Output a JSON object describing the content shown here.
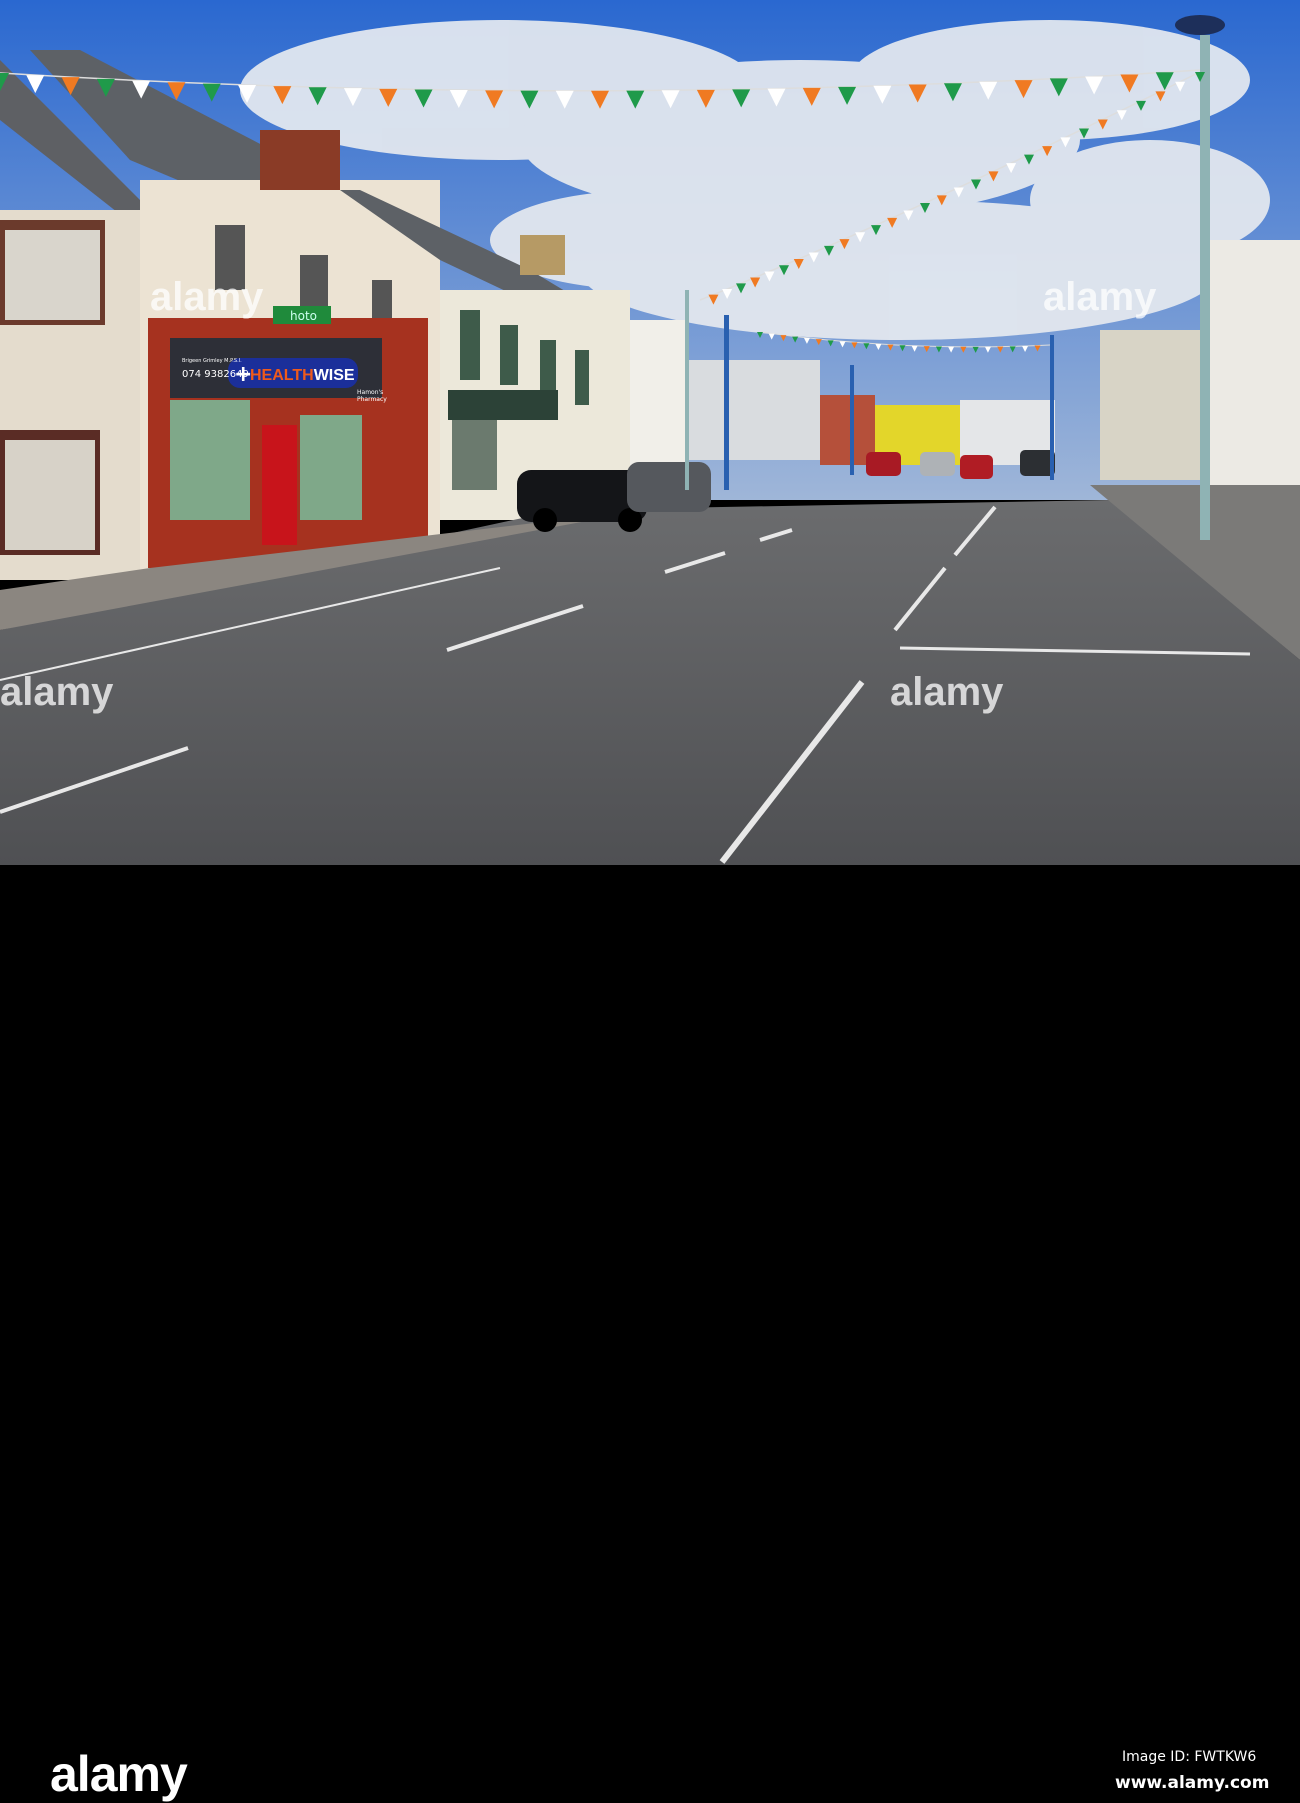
{
  "photo": {
    "shop_sign": {
      "brand_health": "HEALTH",
      "brand_wise": "WISE",
      "owner": "Brigeen Grimley M.P.S.I.",
      "phone": "074 9382649",
      "pharmacy_line1": "Hamon's",
      "pharmacy_line2": "Pharmacy"
    },
    "cross_sign": "hoto",
    "watermark": "alamy"
  },
  "footer": {
    "logo": "alamy",
    "image_id": "Image ID: FWTKW6",
    "website": "www.alamy.com"
  },
  "colors": {
    "sky": "#2f6fd0",
    "road": "#55575a",
    "footer": "#000000",
    "sign_blue": "#1b2f9a",
    "sign_orange": "#f05a1a"
  }
}
